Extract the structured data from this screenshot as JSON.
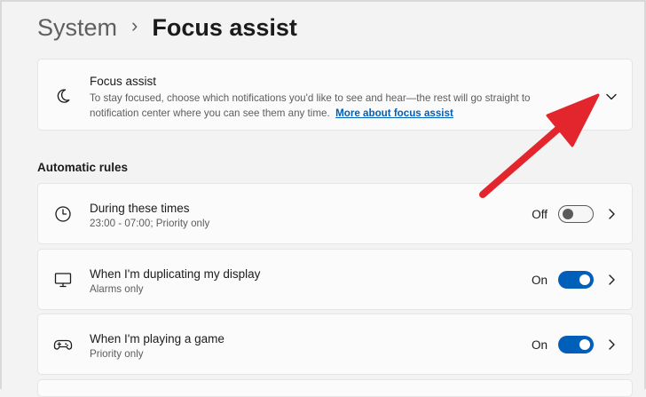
{
  "breadcrumb": {
    "parent": "System",
    "separator": "›",
    "current": "Focus assist"
  },
  "focus_assist": {
    "icon": "moon-icon",
    "title": "Focus assist",
    "description": "To stay focused, choose which notifications you'd like to see and hear—the rest will go straight to notification center where you can see them any time.",
    "link": "More about focus assist",
    "expand_icon": "chevron-down-icon"
  },
  "automatic_rules": {
    "heading": "Automatic rules",
    "items": [
      {
        "icon": "clock-icon",
        "title": "During these times",
        "subtitle": "23:00 - 07:00; Priority only",
        "state": "Off",
        "on": false
      },
      {
        "icon": "monitor-icon",
        "title": "When I'm duplicating my display",
        "subtitle": "Alarms only",
        "state": "On",
        "on": true
      },
      {
        "icon": "gamepad-icon",
        "title": "When I'm playing a game",
        "subtitle": "Priority only",
        "state": "On",
        "on": true
      }
    ]
  },
  "colors": {
    "accent": "#005fb8",
    "annotation_arrow": "#e3262d",
    "background": "#f3f3f3",
    "card": "#fbfbfb"
  }
}
